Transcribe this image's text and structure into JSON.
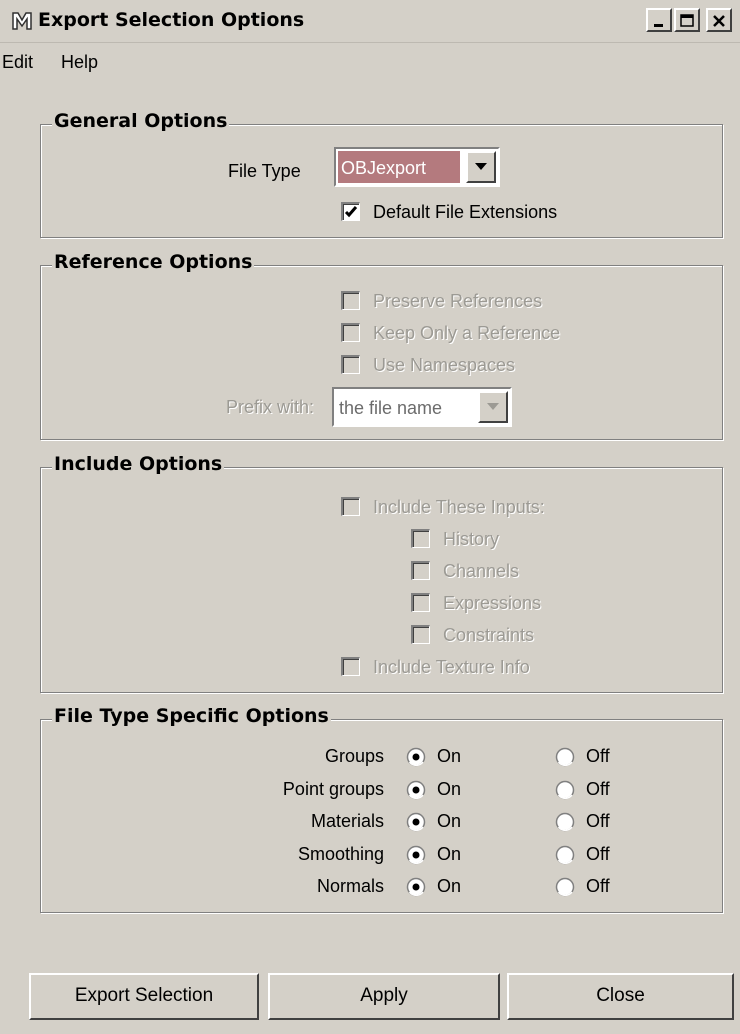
{
  "window": {
    "title": "Export Selection Options",
    "controls": [
      "minimize-icon",
      "maximize-icon",
      "close-icon"
    ]
  },
  "menu": {
    "items": [
      "Edit",
      "Help"
    ]
  },
  "general": {
    "title": "General Options",
    "file_type_label": "File Type",
    "file_type_value": "OBJexport",
    "default_ext_label": "Default File Extensions",
    "default_ext_checked": true
  },
  "reference": {
    "title": "Reference Options",
    "preserve": "Preserve References",
    "keep_only": "Keep Only a Reference",
    "namespaces": "Use Namespaces",
    "prefix_label": "Prefix with:",
    "prefix_value": "the file name"
  },
  "include": {
    "title": "Include Options",
    "inputs": "Include These Inputs:",
    "history": "History",
    "channels": "Channels",
    "expressions": "Expressions",
    "constraints": "Constraints",
    "texture": "Include Texture Info"
  },
  "filetype": {
    "title": "File Type Specific Options",
    "on_label": "On",
    "off_label": "Off",
    "rows": [
      "Groups",
      "Point groups",
      "Materials",
      "Smoothing",
      "Normals"
    ],
    "selected": [
      "On",
      "On",
      "On",
      "On",
      "On"
    ]
  },
  "buttons": {
    "export": "Export Selection",
    "apply": "Apply",
    "close": "Close"
  },
  "colors": {
    "dialog_bg": "#d4d0c8",
    "combo_highlight": "#b47a7e"
  }
}
